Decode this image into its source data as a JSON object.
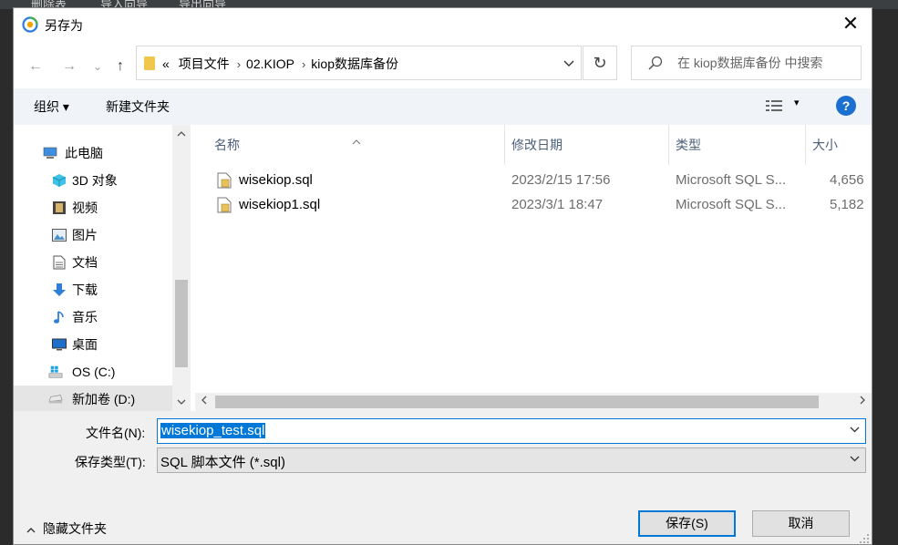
{
  "background": {
    "toolbar_items": [
      "删除表",
      "导入向导",
      "导出向导"
    ]
  },
  "dialog": {
    "title": "另存为",
    "close_symbol": "✕"
  },
  "navigation": {
    "back": "←",
    "forward": "→",
    "recent": "⌄",
    "up": "↑"
  },
  "address": {
    "overflow": "«",
    "crumbs": [
      "项目文件",
      "02.KIOP",
      "kiop数据库备份"
    ],
    "separator": "›",
    "refresh_symbol": "↻"
  },
  "search": {
    "placeholder": "在 kiop数据库备份 中搜索"
  },
  "commandbar": {
    "organize": "组织 ▾",
    "new_folder": "新建文件夹",
    "view_dropdown": "▾",
    "help": "?"
  },
  "sidebar": {
    "items": [
      {
        "label": "此电脑",
        "icon": "computer-icon"
      },
      {
        "label": "3D 对象",
        "icon": "cube-icon"
      },
      {
        "label": "视频",
        "icon": "film-icon"
      },
      {
        "label": "图片",
        "icon": "image-icon"
      },
      {
        "label": "文档",
        "icon": "document-icon"
      },
      {
        "label": "下载",
        "icon": "download-icon"
      },
      {
        "label": "音乐",
        "icon": "music-icon"
      },
      {
        "label": "桌面",
        "icon": "desktop-icon"
      },
      {
        "label": "OS (C:)",
        "icon": "windows-drive-icon"
      },
      {
        "label": "新加卷 (D:)",
        "icon": "drive-icon"
      }
    ]
  },
  "file_list": {
    "columns": [
      "名称",
      "修改日期",
      "类型",
      "大小"
    ],
    "rows": [
      {
        "name": "wisekiop.sql",
        "modified": "2023/2/15 17:56",
        "type": "Microsoft SQL S...",
        "size": "4,656"
      },
      {
        "name": "wisekiop1.sql",
        "modified": "2023/3/1 18:47",
        "type": "Microsoft SQL S...",
        "size": "5,182"
      }
    ]
  },
  "form": {
    "filename_label": "文件名(N):",
    "filename_value": "wisekiop_test.sql",
    "filetype_label": "保存类型(T):",
    "filetype_value": "SQL 脚本文件 (*.sql)"
  },
  "footer": {
    "hide_folders": "隐藏文件夹",
    "save": "保存(S)",
    "cancel": "取消"
  },
  "colors": {
    "accent": "#0078d7",
    "selected_nav": "#cce4f7",
    "header_text": "#4c607a"
  }
}
